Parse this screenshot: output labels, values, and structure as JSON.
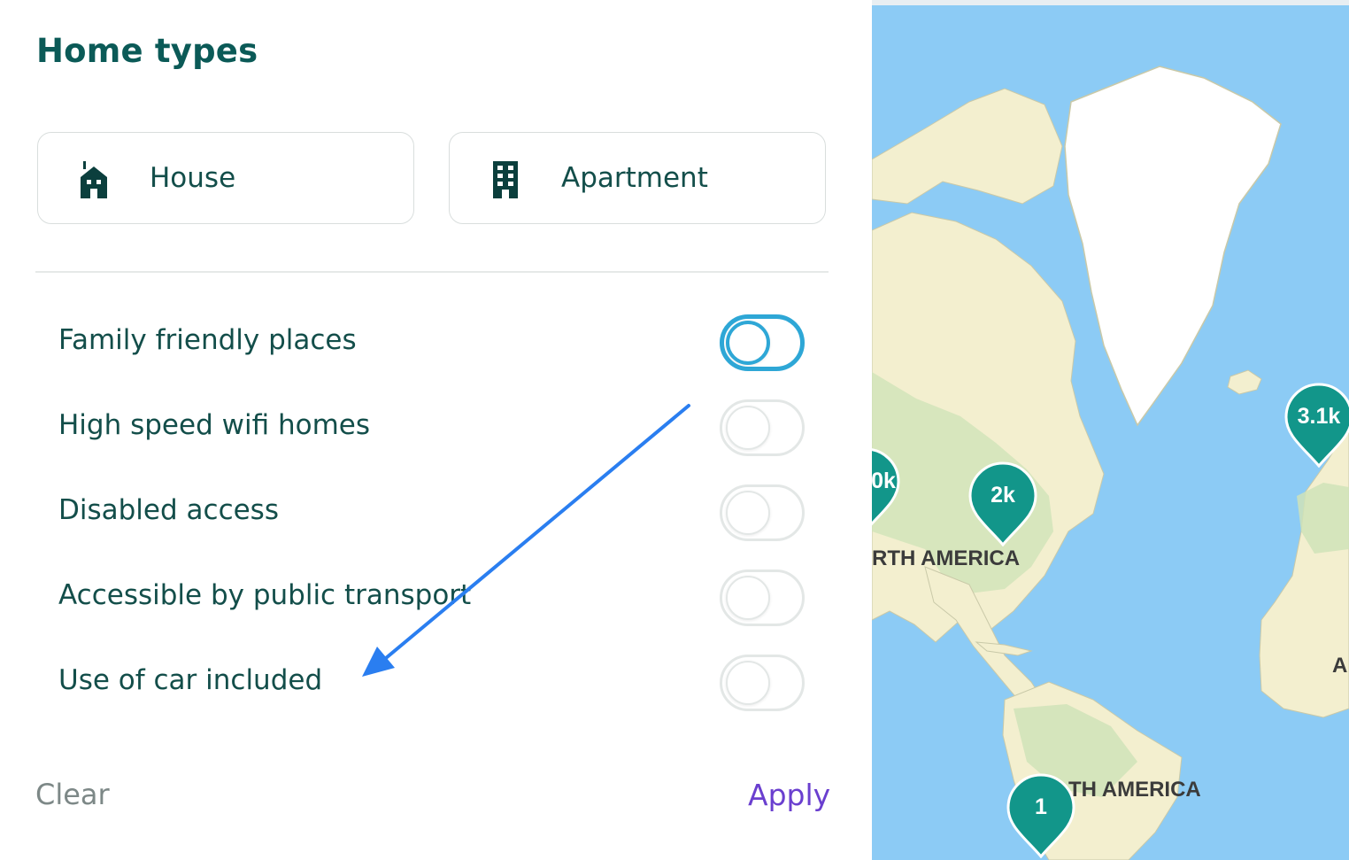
{
  "panel": {
    "title": "Home types",
    "home_types": [
      {
        "label": "House",
        "icon": "house-icon"
      },
      {
        "label": "Apartment",
        "icon": "apartment-icon"
      }
    ],
    "filters": [
      {
        "label": "Family friendly places",
        "on": false,
        "focused": true
      },
      {
        "label": "High speed wifi homes",
        "on": false
      },
      {
        "label": "Disabled access",
        "on": false
      },
      {
        "label": "Accessible by public transport",
        "on": false
      },
      {
        "label": "Use of car included",
        "on": false
      }
    ],
    "clear_label": "Clear",
    "apply_label": "Apply"
  },
  "map": {
    "labels": {
      "north_america": "RTH AMERICA",
      "south_america": "TH AMERICA",
      "africa": "A"
    },
    "pins": [
      {
        "count": "2k"
      },
      {
        "count": "3.1k"
      },
      {
        "count": "1"
      },
      {
        "count": "0k"
      }
    ]
  },
  "colors": {
    "title": "#0b5a57",
    "text": "#134e4a",
    "toggle_focus": "#2ea7d6",
    "apply": "#6a3fcf",
    "clear": "#7d8887",
    "pin": "#12968a",
    "ocean": "#8ccbf5",
    "land": "#f3efcf",
    "forest": "#cfe3b8",
    "annotation_arrow": "#2a7ef0"
  }
}
